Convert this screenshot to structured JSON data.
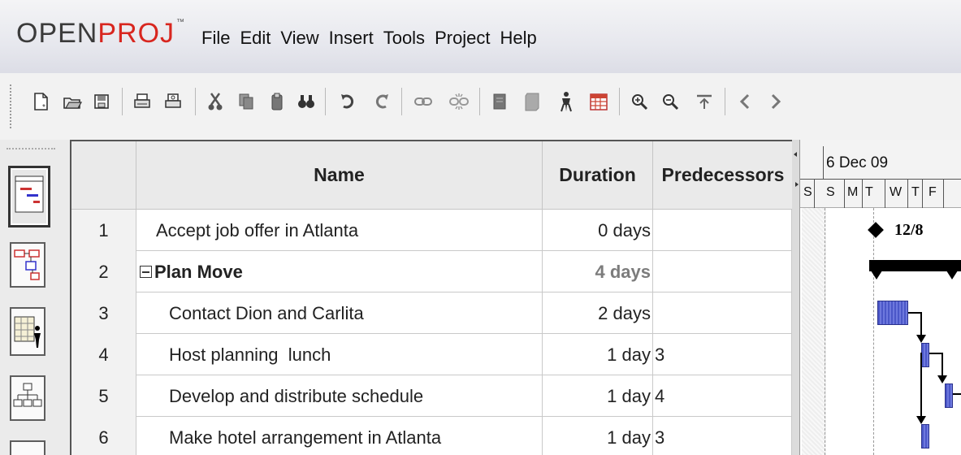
{
  "app": {
    "logo_open": "OPEN",
    "logo_proj": "PROJ",
    "logo_tm": "™"
  },
  "menu": [
    "File",
    "Edit",
    "View",
    "Insert",
    "Tools",
    "Project",
    "Help"
  ],
  "toolbar": {
    "icons": [
      "new-icon",
      "open-icon",
      "save-icon",
      "print-icon",
      "print-preview-icon",
      "cut-icon",
      "copy-icon",
      "paste-icon",
      "find-icon",
      "undo-icon",
      "redo-icon",
      "link-icon",
      "unlink-icon",
      "task-info-icon",
      "notes-icon",
      "resource-icon",
      "calendar-icon",
      "zoom-in-icon",
      "zoom-out-icon",
      "scroll-to-task-icon",
      "scroll-left-icon",
      "scroll-right-icon"
    ]
  },
  "views": [
    "gantt-view",
    "network-view",
    "resource-view",
    "wbs-view"
  ],
  "grid": {
    "headers": {
      "id": "",
      "name": "Name",
      "duration": "Duration",
      "predecessors": "Predecessors"
    },
    "rows": [
      {
        "id": "1",
        "name": "Accept job offer in Atlanta",
        "duration": "0 days",
        "predecessors": ""
      },
      {
        "id": "2",
        "name": "Plan Move",
        "duration": "4 days",
        "predecessors": ""
      },
      {
        "id": "3",
        "name": "Contact Dion and Carlita",
        "duration": "2 days",
        "predecessors": ""
      },
      {
        "id": "4",
        "name": "Host planning  lunch",
        "duration": "1 day",
        "predecessors": "3"
      },
      {
        "id": "5",
        "name": "Develop and distribute schedule",
        "duration": "1 day",
        "predecessors": "4"
      },
      {
        "id": "6",
        "name": "Make hotel arrangement in Atlanta",
        "duration": "1 day",
        "predecessors": "3"
      }
    ]
  },
  "gantt": {
    "week_label": "6 Dec 09",
    "days": [
      "S",
      "S",
      "M",
      "T",
      "W",
      "T",
      "F"
    ],
    "milestone_label": "12/8",
    "colors": {
      "task_bar": "#5c67d6",
      "summary": "#000000",
      "logo_red": "#d8261f"
    }
  }
}
